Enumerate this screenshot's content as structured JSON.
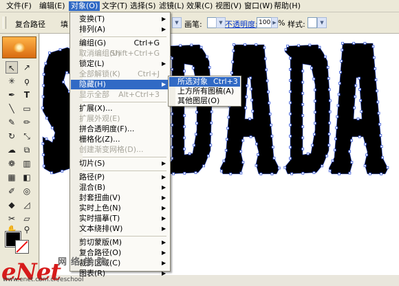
{
  "menubar": {
    "items": [
      {
        "label": "文件(F)"
      },
      {
        "label": "编辑(E)"
      },
      {
        "label": "对象(O)"
      },
      {
        "label": "文字(T)"
      },
      {
        "label": "选择(S)"
      },
      {
        "label": "滤镜(L)"
      },
      {
        "label": "效果(C)"
      },
      {
        "label": "视图(V)"
      },
      {
        "label": "窗口(W)"
      },
      {
        "label": "帮助(H)"
      }
    ]
  },
  "toolbar": {
    "path_label": "复合路径",
    "fill_label": "填",
    "stroke_label": "画笔:",
    "opacity_label": "不透明度:",
    "opacity_value": "100",
    "percent": "%",
    "style_label": "样式:"
  },
  "object_menu": {
    "items": [
      {
        "label": "变换(T)",
        "shortcut": "",
        "submenu": true,
        "disabled": false
      },
      {
        "label": "排列(A)",
        "shortcut": "",
        "submenu": true,
        "disabled": false
      },
      {
        "label": "编组(G)",
        "shortcut": "Ctrl+G",
        "submenu": false,
        "disabled": false
      },
      {
        "label": "取消编组(U)",
        "shortcut": "Shift+Ctrl+G",
        "submenu": false,
        "disabled": true
      },
      {
        "label": "锁定(L)",
        "shortcut": "",
        "submenu": true,
        "disabled": false
      },
      {
        "label": "全部解锁(K)",
        "shortcut": "Ctrl+J",
        "submenu": false,
        "disabled": true
      },
      {
        "label": "隐藏(H)",
        "shortcut": "",
        "submenu": true,
        "disabled": false,
        "highlighted": true
      },
      {
        "label": "显示全部",
        "shortcut": "Alt+Ctrl+3",
        "submenu": false,
        "disabled": true
      },
      {
        "label": "扩展(X)...",
        "shortcut": "",
        "submenu": false,
        "disabled": false
      },
      {
        "label": "扩展外观(E)",
        "shortcut": "",
        "submenu": false,
        "disabled": true
      },
      {
        "label": "拼合透明度(F)...",
        "shortcut": "",
        "submenu": false,
        "disabled": false
      },
      {
        "label": "栅格化(Z)...",
        "shortcut": "",
        "submenu": false,
        "disabled": false
      },
      {
        "label": "创建渐变网格(D)...",
        "shortcut": "",
        "submenu": false,
        "disabled": true
      },
      {
        "label": "切片(S)",
        "shortcut": "",
        "submenu": true,
        "disabled": false
      },
      {
        "label": "路径(P)",
        "shortcut": "",
        "submenu": true,
        "disabled": false
      },
      {
        "label": "混合(B)",
        "shortcut": "",
        "submenu": true,
        "disabled": false
      },
      {
        "label": "封套扭曲(V)",
        "shortcut": "",
        "submenu": true,
        "disabled": false
      },
      {
        "label": "实时上色(N)",
        "shortcut": "",
        "submenu": true,
        "disabled": false
      },
      {
        "label": "实时描摹(T)",
        "shortcut": "",
        "submenu": true,
        "disabled": false
      },
      {
        "label": "文本绕排(W)",
        "shortcut": "",
        "submenu": true,
        "disabled": false
      },
      {
        "label": "剪切蒙版(M)",
        "shortcut": "",
        "submenu": true,
        "disabled": false
      },
      {
        "label": "复合路径(O)",
        "shortcut": "",
        "submenu": true,
        "disabled": false
      },
      {
        "label": "裁剪区域(C)",
        "shortcut": "",
        "submenu": true,
        "disabled": false
      },
      {
        "label": "图表(R)",
        "shortcut": "",
        "submenu": true,
        "disabled": false
      }
    ]
  },
  "hide_submenu": {
    "items": [
      {
        "label": "所选对象",
        "shortcut": "Ctrl+3",
        "highlighted": true
      },
      {
        "label": "上方所有图稿(A)",
        "shortcut": ""
      },
      {
        "label": "其他图层(O)",
        "shortcut": ""
      }
    ]
  },
  "artwork": {
    "text": "SADA"
  },
  "watermark": {
    "brand": "eNet",
    "cn": "网络学院",
    "url": "www.enet.com.cn/eschool"
  },
  "colors": {
    "menu_highlight": "#316ac5",
    "anchor": "#3a5bd9",
    "fill": "#000000",
    "stroke_none": "#e11111"
  }
}
